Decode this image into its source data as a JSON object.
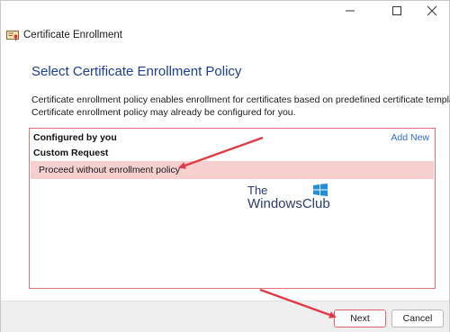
{
  "window": {
    "title": "Certificate Enrollment",
    "controls": [
      "minimize",
      "maximize",
      "close"
    ]
  },
  "page": {
    "heading": "Select Certificate Enrollment Policy",
    "description_line1": "Certificate enrollment policy enables enrollment for certificates based on predefined certificate templates.",
    "description_line2": "Certificate enrollment policy may already be configured for you."
  },
  "policy_list": {
    "header": "Configured by you",
    "add_new_label": "Add New",
    "group_label": "Custom Request",
    "selected_item": "Proceed without enrollment policy"
  },
  "watermark": {
    "line1": "The",
    "line2": "WindowsClub"
  },
  "buttons": {
    "next": "Next",
    "cancel": "Cancel"
  },
  "colors": {
    "heading": "#1c3f96",
    "link": "#2e6bd1",
    "highlight_row": "#f6cfcf",
    "annotation_red": "#e03b45"
  },
  "icons": {
    "title": "certificate-icon",
    "minimize": "minimize-icon",
    "maximize": "maximize-icon",
    "close": "close-icon"
  }
}
